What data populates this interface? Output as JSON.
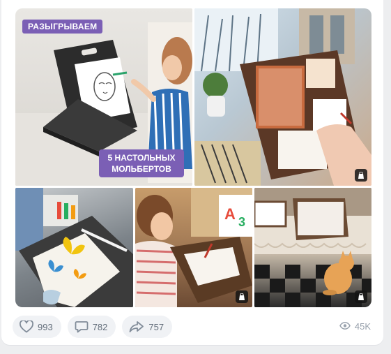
{
  "post": {
    "gallery": {
      "tile1": {
        "badge_top": "РАЗЫГРЫВАЕМ",
        "badge_bottom_line1": "5 НАСТОЛЬНЫХ",
        "badge_bottom_line2": "МОЛЬБЕРТОВ"
      }
    },
    "actions": {
      "likes": "993",
      "comments": "782",
      "shares": "757"
    },
    "views": "45K"
  }
}
